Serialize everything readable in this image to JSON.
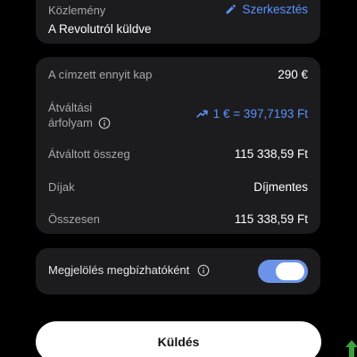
{
  "note": {
    "label": "Közlemény",
    "edit_label": "Szerkesztés",
    "value": "A Revolutról küldve"
  },
  "summary": {
    "recipient_gets_label": "A címzett ennyit kap",
    "recipient_gets_value": "290 €",
    "rate_label_line1": "Átváltási",
    "rate_label_line2": "árfolyam",
    "rate_value": "1 € = 397,7193 Ft",
    "converted_label": "Átváltott összeg",
    "converted_value": "115 338,59 Ft",
    "fees_label": "Díjak",
    "fees_value": "Díjmentes",
    "total_label": "Összesen",
    "total_value": "115 338,59 Ft"
  },
  "trusted": {
    "label": "Megjelölés megbízhatóként",
    "enabled": true
  },
  "send_button": {
    "label": "Küldés"
  },
  "colors": {
    "background": "#000000",
    "card": "#1c1c1e",
    "accent": "#5b93ff",
    "toggle_on": "#6b94e8",
    "muted_text": "#a8a8ad",
    "corner_arrow": "#3aa33a"
  },
  "icons": {
    "edit": "pencil-icon",
    "rate": "trending-up-icon",
    "info": "info-icon",
    "corner": "up-arrow-icon"
  }
}
